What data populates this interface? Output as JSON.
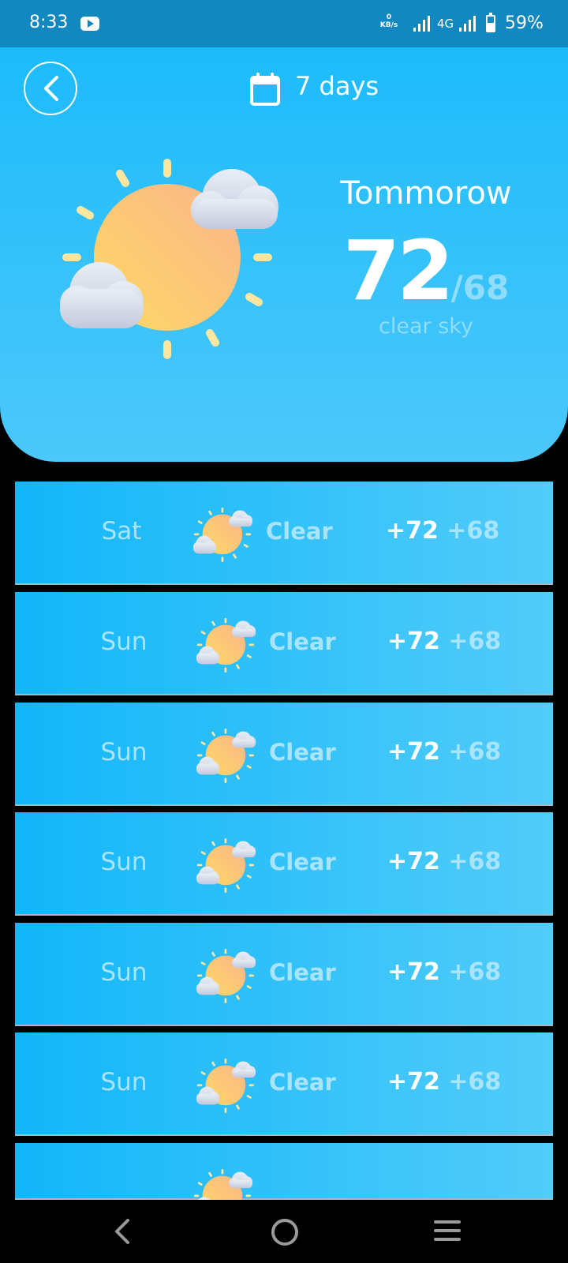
{
  "status_bar": {
    "time": "8:33",
    "net_speed_value": "0",
    "net_speed_unit": "KB/s",
    "network_type": "4G",
    "battery": "59%"
  },
  "header": {
    "title": "7 days",
    "back_icon": "chevron-left-icon",
    "calendar_icon": "calendar-icon"
  },
  "hero": {
    "day": "Tommorow",
    "temp_high": "72",
    "temp_low": "/68",
    "condition": "clear sky",
    "icon": "sun-with-clouds-icon"
  },
  "forecast": [
    {
      "day": "Sat",
      "condition": "Clear",
      "high": "+72",
      "low": "+68"
    },
    {
      "day": "Sun",
      "condition": "Clear",
      "high": "+72",
      "low": "+68"
    },
    {
      "day": "Sun",
      "condition": "Clear",
      "high": "+72",
      "low": "+68"
    },
    {
      "day": "Sun",
      "condition": "Clear",
      "high": "+72",
      "low": "+68"
    },
    {
      "day": "Sun",
      "condition": "Clear",
      "high": "+72",
      "low": "+68"
    },
    {
      "day": "Sun",
      "condition": "Clear",
      "high": "+72",
      "low": "+68"
    },
    {
      "day": "",
      "condition": "",
      "high": "",
      "low": ""
    }
  ],
  "colors": {
    "status_bar": "#1188bf",
    "hero_top": "#1dbbfb",
    "hero_bottom": "#4cc8fa",
    "muted_text": "#a8e4fb"
  }
}
